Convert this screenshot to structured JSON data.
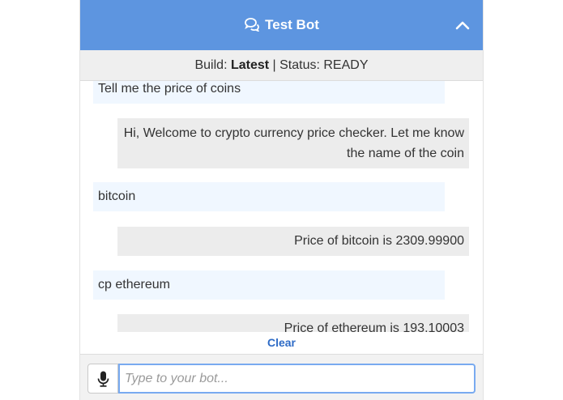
{
  "header": {
    "title": "Test Bot",
    "chat_icon": "chat-bubbles-icon",
    "collapse_icon": "chevron-up-icon",
    "color": "#5d95e0"
  },
  "status": {
    "build_prefix": "Build: ",
    "build_value": "Latest",
    "separator": " | ",
    "status_text": "Status: READY"
  },
  "messages": [
    {
      "from": "human",
      "text": "Tell me the price of coins"
    },
    {
      "from": "bot",
      "text": "Hi, Welcome to crypto currency price checker. Let me know the name of the coin"
    },
    {
      "from": "human",
      "text": "bitcoin"
    },
    {
      "from": "bot",
      "text": "Price of bitcoin is 2309.99900"
    },
    {
      "from": "human",
      "text": "cp ethereum"
    },
    {
      "from": "bot",
      "text": "Price of ethereum is 193.10003"
    }
  ],
  "clear_label": "Clear",
  "input": {
    "placeholder": "Type to your bot...",
    "value": "",
    "mic_icon": "microphone-icon"
  }
}
